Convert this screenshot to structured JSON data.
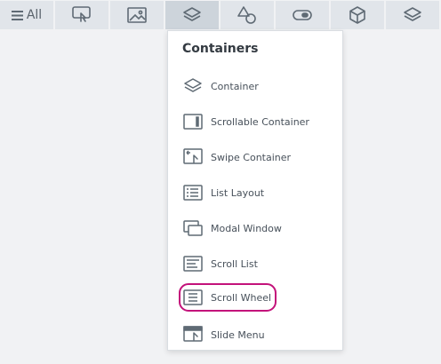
{
  "toolbar": {
    "all_label": "All",
    "buttons": [
      {
        "icon": "touch-screen-icon"
      },
      {
        "icon": "image-icon"
      },
      {
        "icon": "layers-icon",
        "active": true
      },
      {
        "icon": "shapes-icon"
      },
      {
        "icon": "toggle-icon"
      },
      {
        "icon": "cube-icon"
      },
      {
        "icon": "layers-icon"
      }
    ]
  },
  "menu": {
    "title": "Containers",
    "items": [
      {
        "label": "Container",
        "icon": "layers-icon"
      },
      {
        "label": "Scrollable Container",
        "icon": "scrollable-container-icon"
      },
      {
        "label": "Swipe Container",
        "icon": "swipe-container-icon"
      },
      {
        "label": "List Layout",
        "icon": "list-layout-icon"
      },
      {
        "label": "Modal Window",
        "icon": "modal-window-icon"
      },
      {
        "label": "Scroll List",
        "icon": "scroll-list-icon"
      },
      {
        "label": "Scroll Wheel",
        "icon": "scroll-wheel-icon",
        "highlighted": true
      },
      {
        "label": "Slide Menu",
        "icon": "slide-menu-icon"
      }
    ]
  },
  "colors": {
    "toolbar_bg": "#e1e5ea",
    "toolbar_active": "#cdd4db",
    "highlight": "#c3127a",
    "icon": "#5f6a74"
  }
}
